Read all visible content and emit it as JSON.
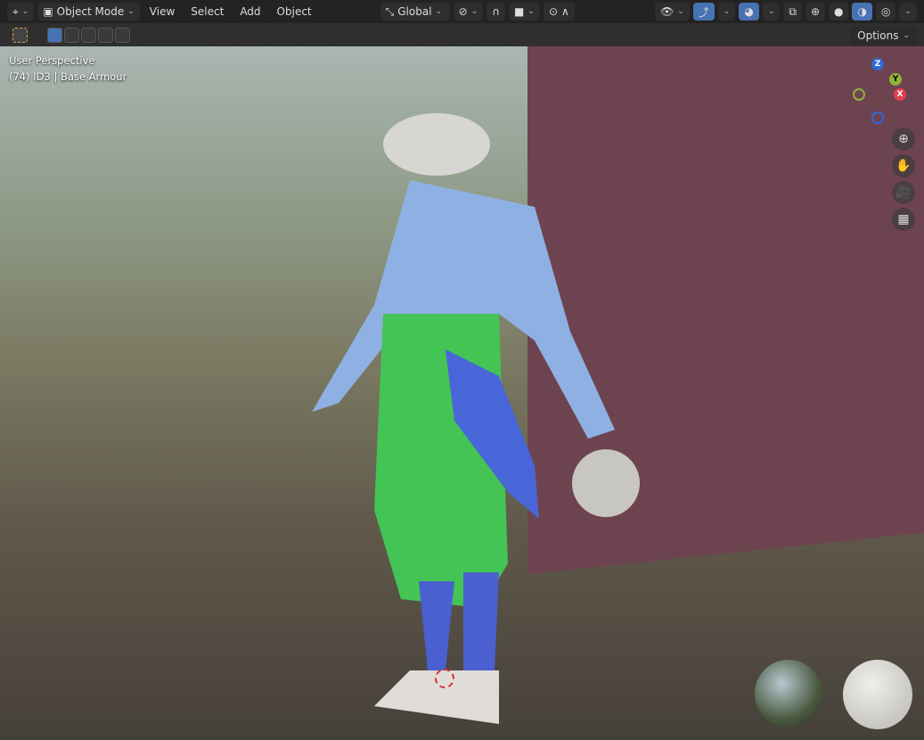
{
  "header": {
    "mode": "Object Mode",
    "menus": [
      "View",
      "Select",
      "Add",
      "Object"
    ],
    "orientation": "Global",
    "options_label": "Options"
  },
  "viewport": {
    "perspective_label": "User Perspective",
    "object_info": "(74) ID3 | Base Armour"
  },
  "gizmo": {
    "z": "Z",
    "y": "Y",
    "x": "X"
  },
  "colors": {
    "accent": "#4772b3",
    "header": "#232323"
  }
}
